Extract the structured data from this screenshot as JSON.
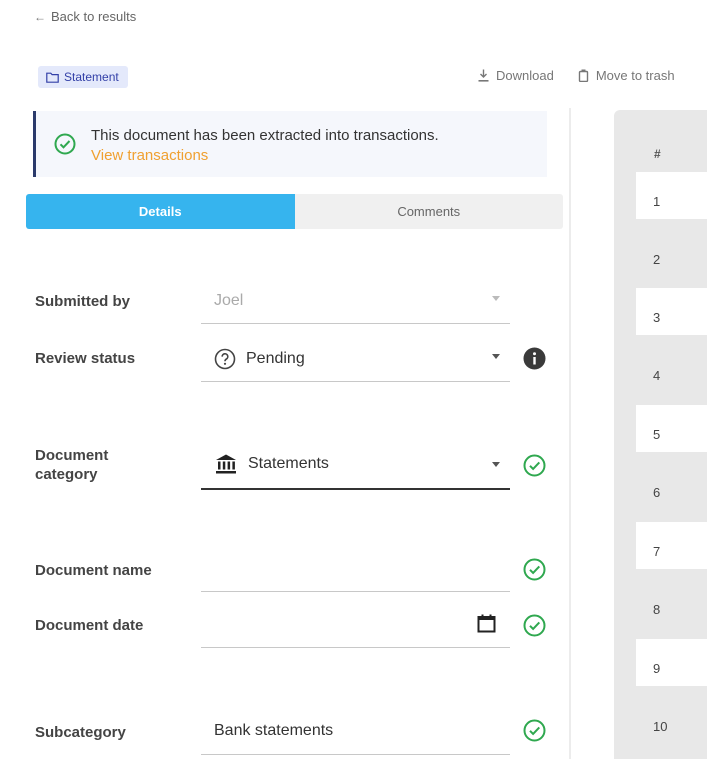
{
  "nav": {
    "back_label": "Back to results"
  },
  "chip": {
    "label": "Statement"
  },
  "actions": {
    "download": "Download",
    "trash": "Move to trash"
  },
  "banner": {
    "message": "This document has been extracted into transactions.",
    "link": "View transactions"
  },
  "tabs": [
    {
      "label": "Details",
      "active": true
    },
    {
      "label": "Comments",
      "active": false
    }
  ],
  "fields": {
    "submitted_by": {
      "label": "Submitted by",
      "value": "Joel"
    },
    "review_status": {
      "label": "Review status",
      "value": "Pending"
    },
    "document_category": {
      "label": "Document category",
      "value": "Statements"
    },
    "document_name": {
      "label": "Document name",
      "value": ""
    },
    "document_date": {
      "label": "Document date",
      "value": ""
    },
    "subcategory": {
      "label": "Subcategory",
      "value": "Bank statements"
    }
  },
  "table": {
    "header": "#",
    "rows": [
      "1",
      "2",
      "3",
      "4",
      "5",
      "6",
      "7",
      "8",
      "9",
      "10"
    ]
  },
  "colors": {
    "accent": "#36b4ee",
    "link": "#f0a030",
    "success": "#2fa84f",
    "chip_bg": "#e4e9fb",
    "chip_text": "#3340a8"
  },
  "icons": {
    "back": "arrow-left-icon",
    "chip": "folder-icon",
    "download": "download-icon",
    "trash": "trash-icon",
    "banner": "check-circle-icon",
    "review_status": "question-circle-icon",
    "info": "info-icon",
    "category": "bank-icon",
    "date": "calendar-icon"
  }
}
